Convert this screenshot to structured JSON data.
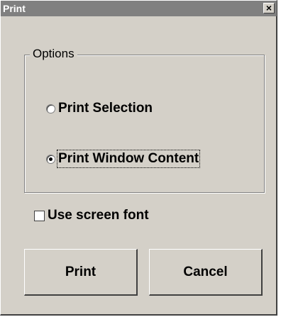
{
  "window": {
    "title": "Print",
    "close_glyph": "×"
  },
  "options_group": {
    "legend": "Options",
    "radios": [
      {
        "label": "Print Selection",
        "selected": false
      },
      {
        "label": "Print Window Content",
        "selected": true
      }
    ]
  },
  "screen_font_checkbox": {
    "label": "Use screen font",
    "checked": false
  },
  "buttons": {
    "print_label": "Print",
    "cancel_label": "Cancel"
  },
  "colors": {
    "face": "#d4d0c8",
    "titlebar": "#808080",
    "title_text": "#ffffff"
  }
}
